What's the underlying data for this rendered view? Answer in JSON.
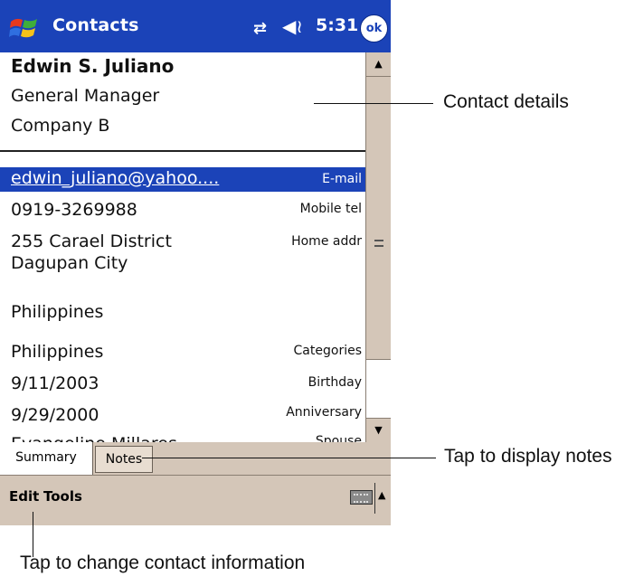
{
  "titlebar": {
    "app_title": "Contacts",
    "clock": "5:31",
    "ok_label": "ok",
    "sync_icon": "sync-icon",
    "volume_icon": "volume-icon"
  },
  "contact": {
    "name": "Edwin S. Juliano",
    "job_title": "General Manager",
    "company": "Company B",
    "fields": {
      "email": {
        "value": "edwin_juliano@yahoo....",
        "label": "E-mail"
      },
      "mobile": {
        "value": "0919-3269988",
        "label": "Mobile tel"
      },
      "home_addr": {
        "line1": "255 Carael District",
        "line2": "Dagupan City",
        "label": "Home addr"
      },
      "country": "Philippines",
      "categories": {
        "value": "Philippines",
        "label": "Categories"
      },
      "birthday": {
        "value": "9/11/2003",
        "label": "Birthday"
      },
      "anniversary": {
        "value": "9/29/2000",
        "label": "Anniversary"
      },
      "spouse": {
        "value": "Evangeline Millares",
        "label": "Spouse"
      }
    }
  },
  "tabs": [
    {
      "label": "Summary",
      "active": true
    },
    {
      "label": "Notes",
      "active": false
    }
  ],
  "menubar": {
    "edit": "Edit",
    "tools": "Tools"
  },
  "callouts": {
    "contact_details": "Contact details",
    "display_notes": "Tap to display notes",
    "change_info": "Tap to change contact information"
  },
  "colors": {
    "titlebar": "#1b43b8",
    "chrome": "#d4c6b8",
    "selection": "#1b43b8"
  }
}
